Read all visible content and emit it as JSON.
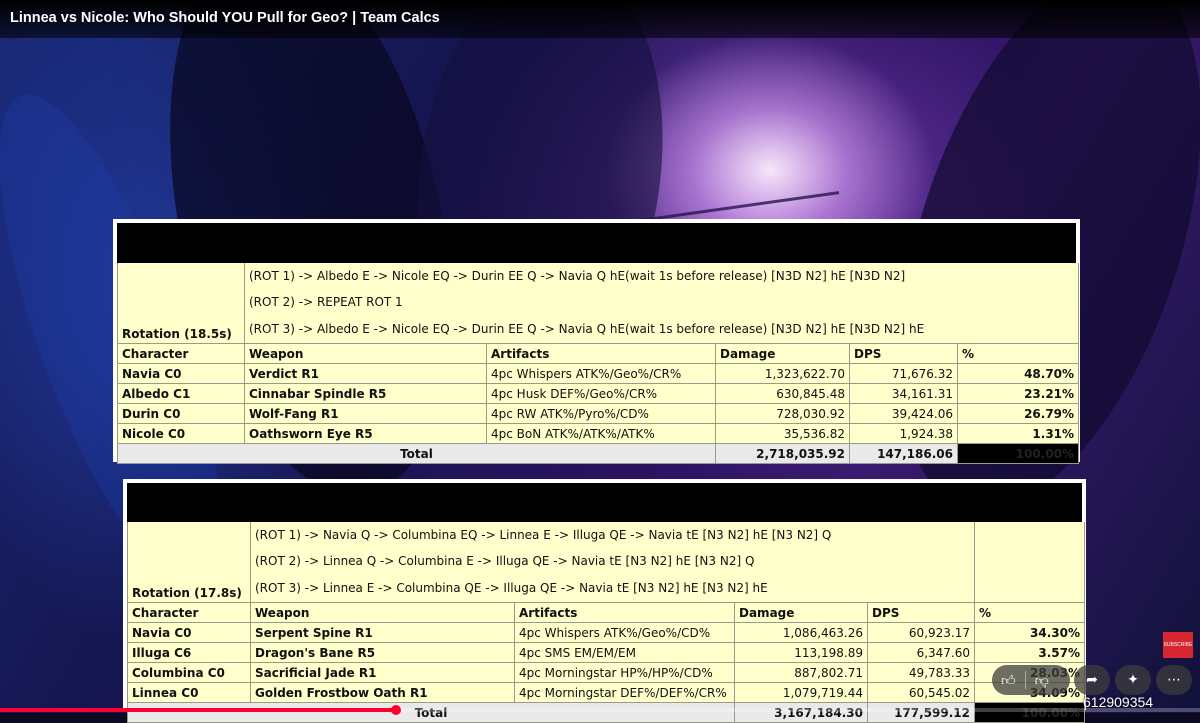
{
  "video": {
    "title": "Linnea vs Nicole: Who Should YOU Pull for Geo? | Team Calcs",
    "progress_fraction": 0.33,
    "subscribe_badge": "SUBSCRIBE",
    "counter_text": "612909354"
  },
  "colors": {
    "cell_bg": "#ffffcc",
    "total_bg": "#e9e9e9",
    "accent_red": "#ff0033"
  },
  "icons": {
    "like": "thumbs-up-icon",
    "dislike": "thumbs-down-icon",
    "share": "share-arrow-icon",
    "remix": "sparkle-icon",
    "more": "more-horizontal-icon"
  },
  "table1": {
    "rotation_label": "Rotation (18.5s)",
    "rotations": [
      "(ROT 1) -> Albedo E -> Nicole EQ -> Durin EE Q -> Navia Q hE(wait 1s before release) [N3D N2] hE [N3D N2]",
      "(ROT 2) -> REPEAT ROT 1",
      "(ROT 3) -> Albedo E -> Nicole EQ -> Durin EE Q -> Navia Q hE(wait 1s before release) [N3D N2] hE [N3D N2] hE"
    ],
    "headers": [
      "Character",
      "Weapon",
      "Artifacts",
      "Damage",
      "DPS",
      "%"
    ],
    "rows": [
      [
        "Navia C0",
        "Verdict R1",
        "4pc Whispers ATK%/Geo%/CR%",
        "1,323,622.70",
        "71,676.32",
        "48.70%"
      ],
      [
        "Albedo C1",
        "Cinnabar Spindle R5",
        "4pc Husk DEF%/Geo%/CR%",
        "630,845.48",
        "34,161.31",
        "23.21%"
      ],
      [
        "Durin C0",
        "Wolf-Fang R1",
        "4pc RW ATK%/Pyro%/CD%",
        "728,030.92",
        "39,424.06",
        "26.79%"
      ],
      [
        "Nicole C0",
        "Oathsworn Eye R5",
        "4pc BoN ATK%/ATK%/ATK%",
        "35,536.82",
        "1,924.38",
        "1.31%"
      ]
    ],
    "total": {
      "label": "Total",
      "damage": "2,718,035.92",
      "dps": "147,186.06",
      "pct": "100.00%"
    }
  },
  "table2": {
    "rotation_label": "Rotation (17.8s)",
    "rotations": [
      "(ROT 1) -> Navia Q -> Columbina EQ -> Linnea E -> Illuga QE -> Navia tE [N3 N2] hE [N3 N2] Q",
      "(ROT 2) -> Linnea Q -> Columbina E -> Illuga QE -> Navia tE [N3 N2] hE [N3 N2] Q",
      "(ROT 3) -> Linnea E -> Columbina QE -> Illuga QE -> Navia tE [N3 N2] hE [N3 N2] hE"
    ],
    "headers": [
      "Character",
      "Weapon",
      "Artifacts",
      "Damage",
      "DPS",
      "%"
    ],
    "rows": [
      [
        "Navia C0",
        "Serpent Spine R1",
        "4pc Whispers ATK%/Geo%/CD%",
        "1,086,463.26",
        "60,923.17",
        "34.30%"
      ],
      [
        "Illuga C6",
        "Dragon's Bane R5",
        "4pc SMS EM/EM/EM",
        "113,198.89",
        "6,347.60",
        "3.57%"
      ],
      [
        "Columbina C0",
        "Sacrificial Jade R1",
        "4pc Morningstar HP%/HP%/CD%",
        "887,802.71",
        "49,783.33",
        "28.03%"
      ],
      [
        "Linnea C0",
        "Golden Frostbow Oath R1",
        "4pc Morningstar DEF%/DEF%/CR%",
        "1,079,719.44",
        "60,545.02",
        "34.09%"
      ]
    ],
    "total": {
      "label": "Total",
      "damage": "3,167,184.30",
      "dps": "177,599.12",
      "pct": "100.00%"
    }
  }
}
